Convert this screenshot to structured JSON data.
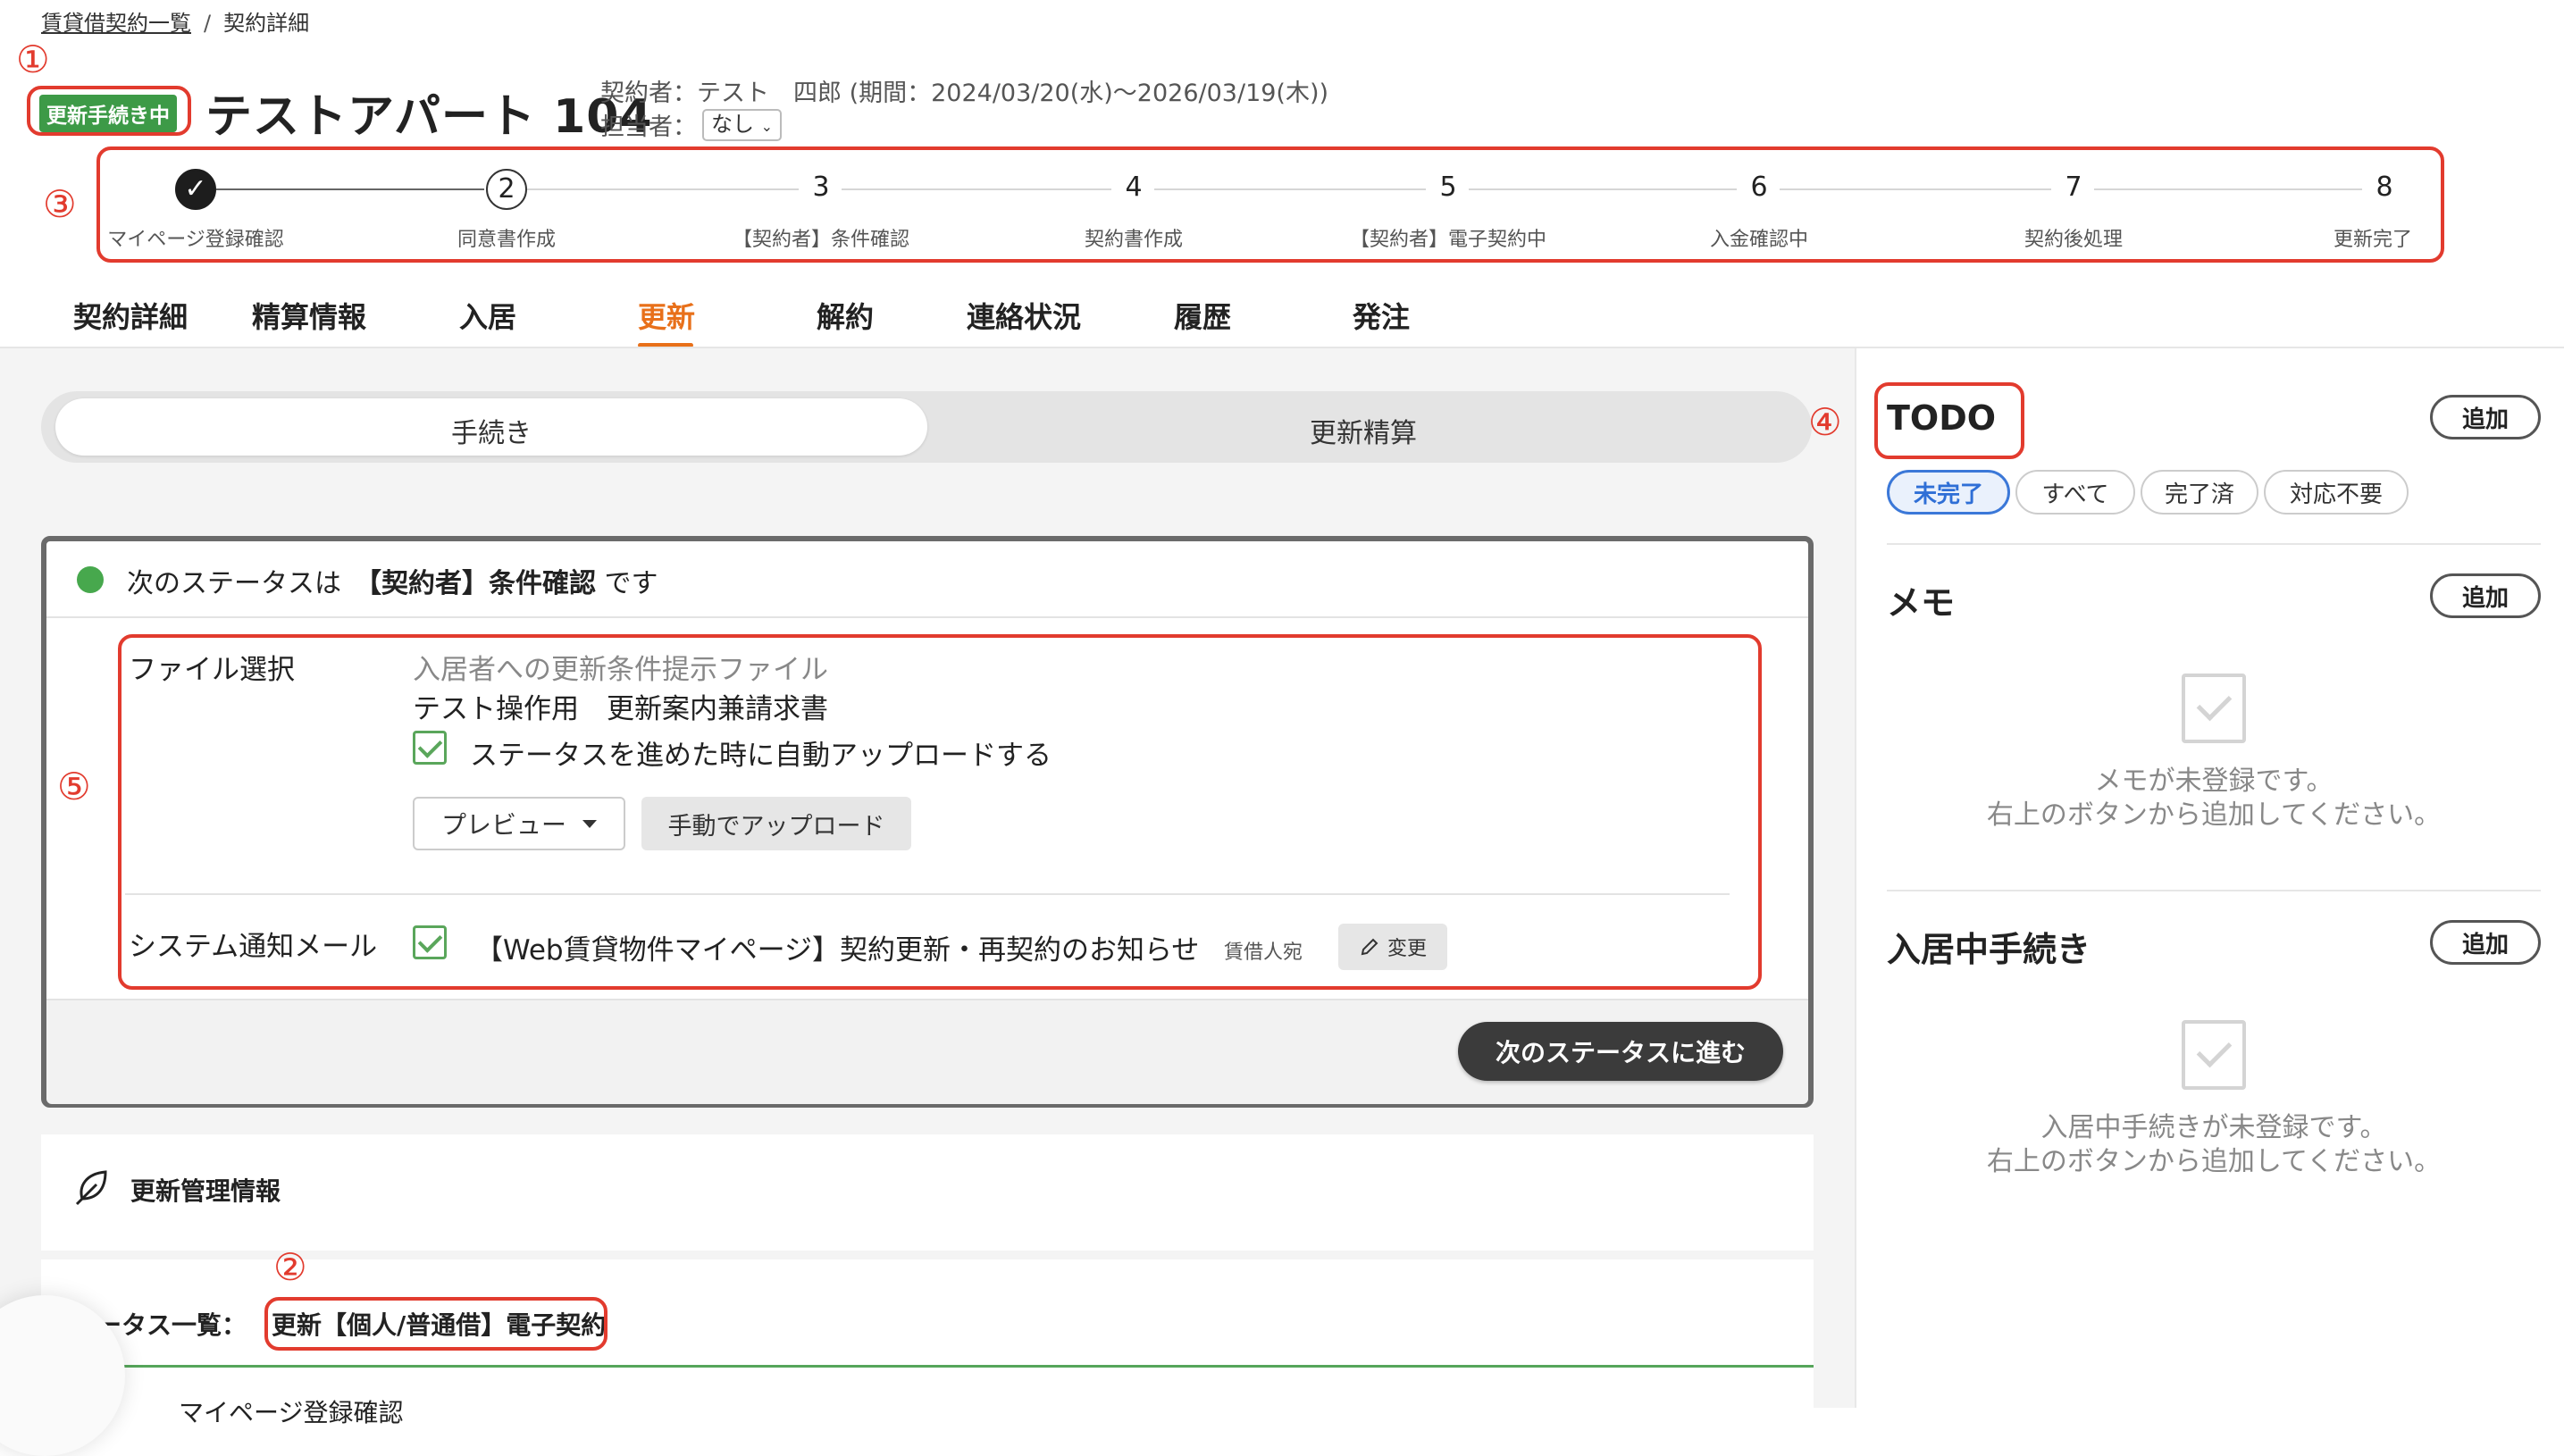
{
  "breadcrumb": {
    "parent": "賃貸借契約一覧",
    "separator": "/",
    "current": "契約詳細"
  },
  "header": {
    "status_badge": "更新手続き中",
    "title": "テストアパート 104",
    "contract_info": "契約者：テスト　四郎 (期間：2024/03/20(水)〜2026/03/19(木))",
    "assignee_label": "担当者：",
    "assignee_value": "なし"
  },
  "markers": {
    "m1": "①",
    "m2": "②",
    "m3": "③",
    "m4": "④",
    "m5": "⑤"
  },
  "stepper": {
    "steps": [
      {
        "number": "1",
        "label": "マイページ登録確認",
        "state": "done"
      },
      {
        "number": "2",
        "label": "同意書作成",
        "state": "current"
      },
      {
        "number": "3",
        "label": "【契約者】条件確認",
        "state": "pending"
      },
      {
        "number": "4",
        "label": "契約書作成",
        "state": "pending"
      },
      {
        "number": "5",
        "label": "【契約者】電子契約中",
        "state": "pending"
      },
      {
        "number": "6",
        "label": "入金確認中",
        "state": "pending"
      },
      {
        "number": "7",
        "label": "契約後処理",
        "state": "pending"
      },
      {
        "number": "8",
        "label": "更新完了",
        "state": "pending"
      }
    ]
  },
  "tabs": [
    {
      "label": "契約詳細"
    },
    {
      "label": "精算情報"
    },
    {
      "label": "入居"
    },
    {
      "label": "更新",
      "active": true
    },
    {
      "label": "解約"
    },
    {
      "label": "連絡状況"
    },
    {
      "label": "履歴"
    },
    {
      "label": "発注"
    }
  ],
  "segmented": {
    "left": "手続き",
    "right": "更新精算"
  },
  "status_card": {
    "prefix": "次のステータスは",
    "status_name": "【契約者】条件確認",
    "suffix": "です",
    "file_select_label": "ファイル選択",
    "file_placeholder": "入居者への更新条件提示ファイル",
    "file_name": "テスト操作用　更新案内兼請求書",
    "auto_upload_label": "ステータスを進めた時に自動アップロードする",
    "preview_label": "プレビュー",
    "manual_upload_label": "手動でアップロード",
    "mail_label": "システム通知メール",
    "mail_subject": "【Web賃貸物件マイページ】契約更新・再契約のお知らせ",
    "mail_recipient": "賃借人宛",
    "change_label": "変更",
    "next_button": "次のステータスに進む"
  },
  "renewal_info": {
    "title": "更新管理情報",
    "status_list_label": "ータス一覧：",
    "status_list_value": "更新【個人/普通借】電子契約",
    "cut_item": "マイページ登録確認"
  },
  "right_panel": {
    "todo": {
      "title": "TODO",
      "add_label": "追加",
      "filters": [
        "未完了",
        "すべて",
        "完了済",
        "対応不要"
      ]
    },
    "memo": {
      "title": "メモ",
      "add_label": "追加",
      "empty_line1": "メモが未登録です。",
      "empty_line2": "右上のボタンから追加してください。"
    },
    "move_in": {
      "title": "入居中手続き",
      "add_label": "追加",
      "empty_line1": "入居中手続きが未登録です。",
      "empty_line2": "右上のボタンから追加してください。"
    }
  },
  "colors": {
    "accent_orange": "#e8701a",
    "badge_green": "#3d9a47",
    "annotation_red": "#e23b2e",
    "filter_blue": "#3b78d8"
  }
}
